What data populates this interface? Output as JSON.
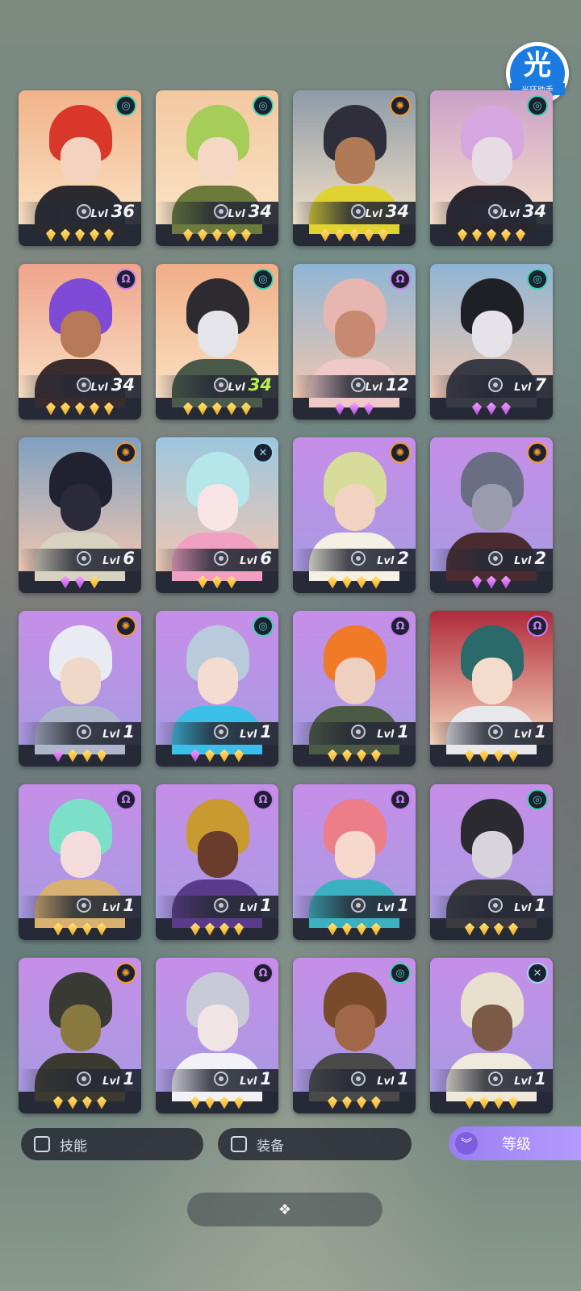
{
  "logo": {
    "big": "光",
    "small": "光环助手"
  },
  "level_prefix": "Lvl",
  "cards": [
    {
      "name": "red-hair",
      "bg": "#f1b38a",
      "hair": "#d8372a",
      "skin": "#f4d2c0",
      "outfit": "#2b2b2f",
      "element": "nature",
      "level": "36",
      "gems": [
        "gold",
        "gold",
        "gold",
        "gold",
        "gold"
      ]
    },
    {
      "name": "green-hair",
      "bg": "#f2c8a0",
      "hair": "#a6cc5a",
      "skin": "#f4d8c4",
      "outfit": "#6c7a3c",
      "element": "nature",
      "level": "34",
      "gems": [
        "gold",
        "gold",
        "gold",
        "gold",
        "gold"
      ]
    },
    {
      "name": "dark-hair-yellow",
      "bg": "#8d9aa8",
      "hair": "#2e2f3a",
      "skin": "#b07a56",
      "outfit": "#e0d230",
      "element": "fire",
      "level": "34",
      "gems": [
        "gold",
        "gold",
        "gold",
        "gold",
        "gold"
      ]
    },
    {
      "name": "pink-cap",
      "bg": "#caa0c8",
      "hair": "#d6a6e0",
      "skin": "#e8dce4",
      "outfit": "#2a2630",
      "element": "nature",
      "level": "34",
      "gems": [
        "gold",
        "gold",
        "gold",
        "gold",
        "gold"
      ]
    },
    {
      "name": "purple-hair",
      "bg": "#efa38c",
      "hair": "#7f4ad6",
      "skin": "#b67a58",
      "outfit": "#3a2c2e",
      "element": "void",
      "level": "34",
      "gems": [
        "gold",
        "gold",
        "gold",
        "gold",
        "gold"
      ]
    },
    {
      "name": "white-tiger",
      "bg": "#f1ae86",
      "hair": "#2d2b30",
      "skin": "#e4e4ea",
      "outfit": "#4a5a4a",
      "element": "nature",
      "level": "34",
      "highlight": true,
      "gems": [
        "gold",
        "gold",
        "gold",
        "gold",
        "gold"
      ]
    },
    {
      "name": "pink-mermaid",
      "bg": "#8fb5d4",
      "hair": "#e8b6b0",
      "skin": "#c78a70",
      "outfit": "#f0c8c8",
      "element": "void",
      "level": "12",
      "gems": [
        "purple",
        "purple",
        "purple"
      ]
    },
    {
      "name": "black-hair-blue",
      "bg": "#8fb5d4",
      "hair": "#1f2026",
      "skin": "#e6e2ea",
      "outfit": "#3a3a44",
      "element": "nature",
      "level": "7",
      "gems": [
        "purple",
        "purple",
        "purple"
      ]
    },
    {
      "name": "anubis",
      "bg": "#7fa0c0",
      "hair": "#202232",
      "skin": "#2a2a3a",
      "outfit": "#d8d2c0",
      "element": "fire",
      "level": "6",
      "gems": [
        "purple",
        "purple",
        "gold"
      ]
    },
    {
      "name": "pastel-girl",
      "bg": "#9cc6e0",
      "hair": "#b4e6ea",
      "skin": "#f8e4e4",
      "outfit": "#f0a0c0",
      "element": "wind",
      "level": "6",
      "gems": [
        "gold",
        "gold",
        "gold"
      ]
    },
    {
      "name": "veil-girl",
      "bg": "#c79ae6",
      "hair": "#d8dc9a",
      "skin": "#f2d2c0",
      "outfit": "#f4f0e4",
      "element": "fire",
      "level": "2",
      "gems": [
        "gold",
        "gold",
        "gold",
        "gold"
      ]
    },
    {
      "name": "werewolf",
      "bg": "#c79ae6",
      "hair": "#6a6e82",
      "skin": "#9a9cae",
      "outfit": "#4a2c30",
      "element": "fire",
      "level": "2",
      "gems": [
        "purple",
        "purple",
        "purple"
      ]
    },
    {
      "name": "old-man",
      "bg": "#c79ae6",
      "hair": "#e8ecf2",
      "skin": "#f0d8c8",
      "outfit": "#aeb6cc",
      "element": "fire",
      "level": "1",
      "gems": [
        "purple",
        "gold",
        "gold",
        "gold"
      ]
    },
    {
      "name": "silver-hair",
      "bg": "#c79ae6",
      "hair": "#b8cadc",
      "skin": "#f4dcd0",
      "outfit": "#3ac0e8",
      "element": "nature",
      "level": "1",
      "gems": [
        "purple",
        "gold",
        "gold",
        "gold"
      ]
    },
    {
      "name": "orange-hat",
      "bg": "#c79ae6",
      "hair": "#f07a28",
      "skin": "#eed0c0",
      "outfit": "#4a5a44",
      "element": "void",
      "level": "1",
      "gems": [
        "gold",
        "gold",
        "gold",
        "gold"
      ]
    },
    {
      "name": "umbrella-girl",
      "bg": "#b02a3a",
      "hair": "#2a6a6a",
      "skin": "#f4dccc",
      "outfit": "#e8e8ec",
      "element": "void",
      "level": "1",
      "gems": [
        "gold",
        "gold",
        "gold",
        "gold"
      ]
    },
    {
      "name": "teal-bob",
      "bg": "#c79ae6",
      "hair": "#7ce0c8",
      "skin": "#f4dcdc",
      "outfit": "#d8b070",
      "element": "void",
      "level": "1",
      "gems": [
        "gold",
        "gold",
        "gold",
        "gold"
      ]
    },
    {
      "name": "masked-king",
      "bg": "#c79ae6",
      "hair": "#c99a30",
      "skin": "#6a3c2c",
      "outfit": "#5a3a8a",
      "element": "void",
      "level": "1",
      "gems": [
        "gold",
        "gold",
        "gold",
        "gold"
      ]
    },
    {
      "name": "pink-curls",
      "bg": "#c79ae6",
      "hair": "#ec7e8a",
      "skin": "#f6d8cc",
      "outfit": "#3ab0c0",
      "element": "void",
      "level": "1",
      "gems": [
        "gold",
        "gold",
        "gold",
        "gold"
      ]
    },
    {
      "name": "samurai",
      "bg": "#c79ae6",
      "hair": "#2a2a30",
      "skin": "#d8d4dc",
      "outfit": "#3a3a40",
      "element": "nature",
      "level": "1",
      "gems": [
        "gold",
        "gold",
        "gold",
        "gold"
      ]
    },
    {
      "name": "golden-jackal",
      "bg": "#c79ae6",
      "hair": "#3a3a34",
      "skin": "#8a7a40",
      "outfit": "#3c3a30",
      "element": "fire",
      "level": "1",
      "gems": [
        "gold",
        "gold",
        "gold",
        "gold"
      ]
    },
    {
      "name": "white-mask",
      "bg": "#c79ae6",
      "hair": "#c8cad8",
      "skin": "#f0e4e4",
      "outfit": "#f2f2f6",
      "element": "void",
      "level": "1",
      "gems": [
        "gold",
        "gold",
        "gold",
        "gold"
      ]
    },
    {
      "name": "horned-goggles",
      "bg": "#c79ae6",
      "hair": "#7a4a2a",
      "skin": "#a06848",
      "outfit": "#4a4a4a",
      "element": "nature",
      "level": "1",
      "gems": [
        "gold",
        "gold",
        "gold",
        "gold"
      ]
    },
    {
      "name": "blonde-green",
      "bg": "#c79ae6",
      "hair": "#e8e0cc",
      "skin": "#7c5a48",
      "outfit": "#f0eadc",
      "element": "wind",
      "level": "1",
      "gems": [
        "gold",
        "gold",
        "gold",
        "gold"
      ]
    }
  ],
  "element_colors": {
    "nature": "#3ad6b0",
    "fire": "#f29a2c",
    "void": "#c57ef0",
    "wind": "#9ad8f0"
  },
  "element_glyphs": {
    "nature": "◎",
    "fire": "✺",
    "void": "Ω",
    "wind": "✕"
  },
  "filters": {
    "skill": "技能",
    "equip": "装备",
    "sort": "等级"
  },
  "bottom_icon": "❖"
}
